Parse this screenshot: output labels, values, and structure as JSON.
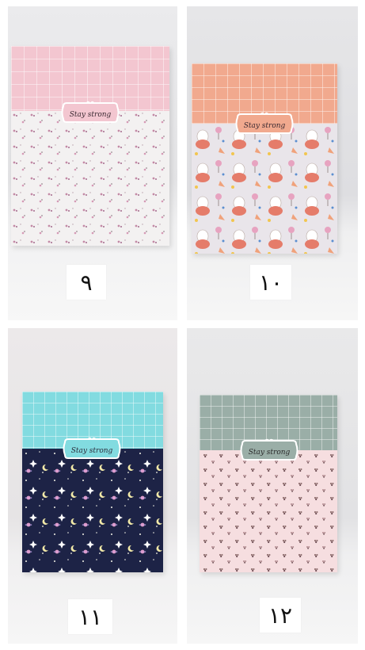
{
  "products": [
    {
      "number": "۹",
      "label": "Stay strong",
      "colors": {
        "top": "#f3c6d0",
        "bottom": "#f3f1f1",
        "pattern": "#c48aa6"
      }
    },
    {
      "number": "۱۰",
      "label": "Stay strong",
      "colors": {
        "top": "#f1a98e",
        "bottom": "#e9e5ea",
        "pattern": "#e57c6a"
      }
    },
    {
      "number": "۱۱",
      "label": "Stay strong",
      "colors": {
        "top": "#82dbe0",
        "bottom": "#1d2346",
        "pattern": "#f4f2e6"
      }
    },
    {
      "number": "۱۲",
      "label": "Stay strong",
      "colors": {
        "top": "#9aaea7",
        "bottom": "#f6dee0",
        "pattern": "#8f6f6f"
      }
    }
  ]
}
